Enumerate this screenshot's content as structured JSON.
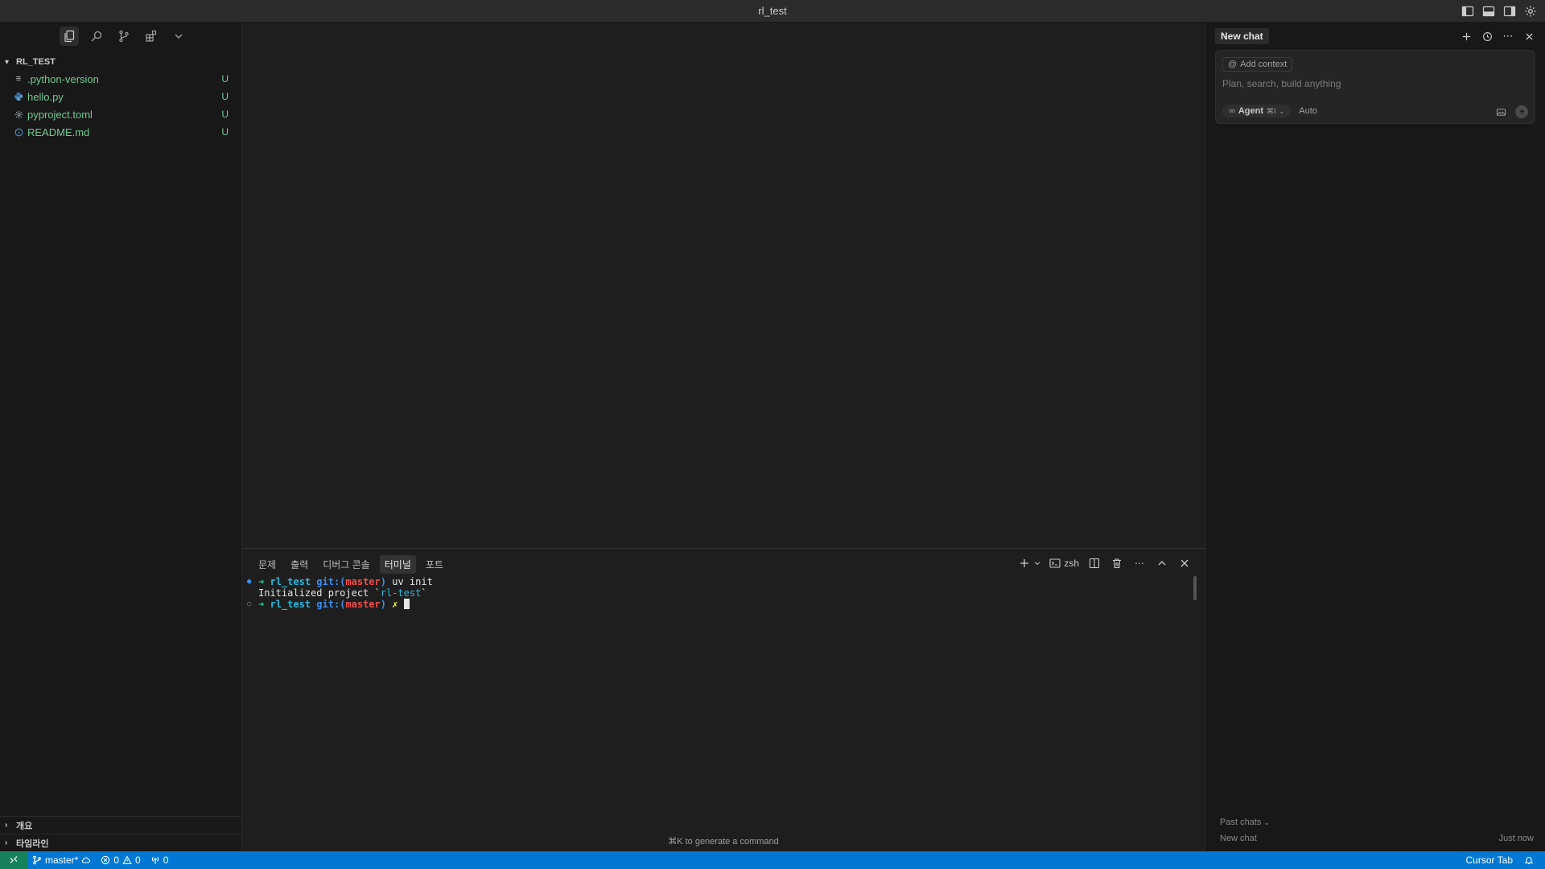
{
  "window": {
    "title": "rl_test"
  },
  "explorer": {
    "root": "RL_TEST",
    "files": [
      {
        "name": ".python-version",
        "icon": "lines-icon",
        "status": "U"
      },
      {
        "name": "hello.py",
        "icon": "python-icon",
        "status": "U"
      },
      {
        "name": "pyproject.toml",
        "icon": "gear-icon",
        "status": "U"
      },
      {
        "name": "README.md",
        "icon": "info-icon",
        "status": "U"
      }
    ],
    "sections": [
      "개요",
      "타임라인"
    ]
  },
  "panel": {
    "tabs": [
      "문제",
      "출력",
      "디버그 콘솔",
      "터미널",
      "포트"
    ],
    "active_tab": "터미널",
    "shell": "zsh",
    "terminal": {
      "line1": {
        "arrow": "➜",
        "dir": "rl_test",
        "git": "git:(",
        "branch": "master",
        "git_close": ")",
        "cmd": " uv init"
      },
      "line2": {
        "text": "Initialized project `",
        "project": "rl-test",
        "tail": "`"
      },
      "line3": {
        "arrow": "➜",
        "dir": "rl_test",
        "git": "git:(",
        "branch": "master",
        "git_close": ")",
        "dirty": " ✗ "
      }
    },
    "hint": "⌘K to generate a command"
  },
  "chat": {
    "tab": "New chat",
    "add_context": "Add context",
    "placeholder": "Plan, search, build anything",
    "agent_label": "Agent",
    "agent_shortcut": "⌘I",
    "mode": "Auto",
    "past_label": "Past chats",
    "past_items": [
      {
        "title": "New chat",
        "time": "Just now"
      }
    ]
  },
  "statusbar": {
    "branch": "master*",
    "errors": "0",
    "warnings": "0",
    "ports": "0",
    "right_label": "Cursor Tab"
  },
  "colors": {
    "statusbar": "#0078d4",
    "remote": "#16825d",
    "untracked": "#73c991"
  }
}
